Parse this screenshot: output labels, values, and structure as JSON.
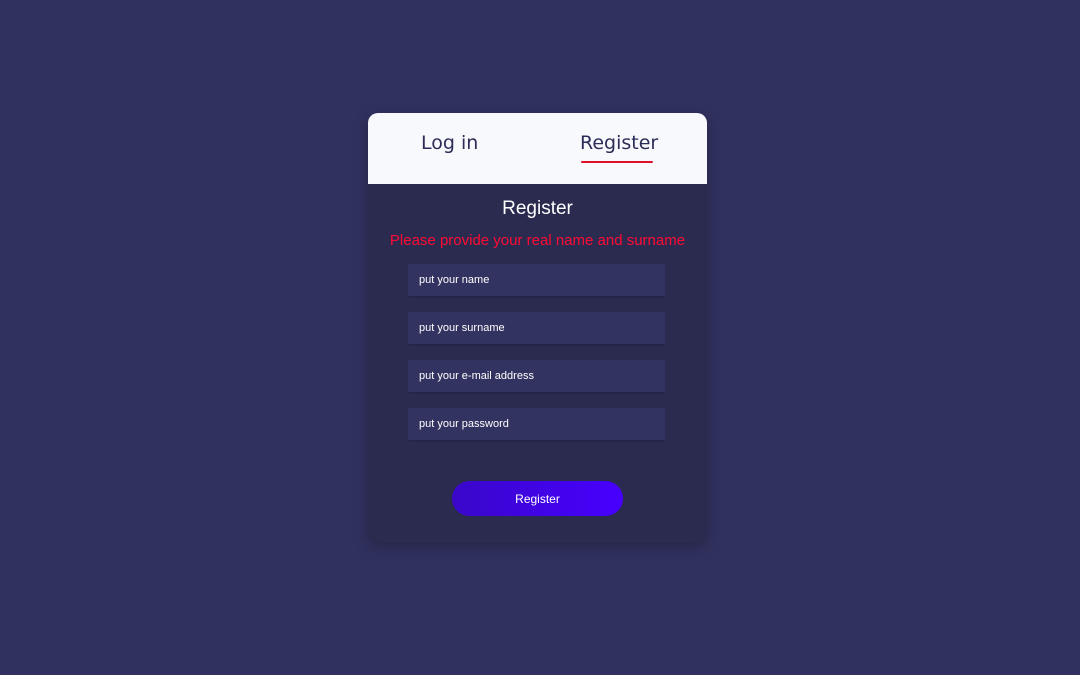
{
  "tabs": {
    "login_label": "Log in",
    "register_label": "Register",
    "active": "Register"
  },
  "form": {
    "title": "Register",
    "warning": "Please provide your real name and surname",
    "fields": {
      "name": {
        "placeholder": "put your name",
        "value": ""
      },
      "surname": {
        "placeholder": "put your surname",
        "value": ""
      },
      "email": {
        "placeholder": "put your e-mail address",
        "value": ""
      },
      "password": {
        "placeholder": "put your password",
        "value": ""
      }
    },
    "submit_label": "Register"
  },
  "colors": {
    "page_background": "#31315f",
    "card_background": "#2b2b50",
    "tab_bar_background": "#f8f9fc",
    "tab_text": "#2c2c58",
    "active_tab_underline": "#e0102a",
    "warning_text": "#ff0a35",
    "input_background": "#333362",
    "button_gradient_start": "#3a07c9",
    "button_gradient_end": "#4700ff"
  }
}
